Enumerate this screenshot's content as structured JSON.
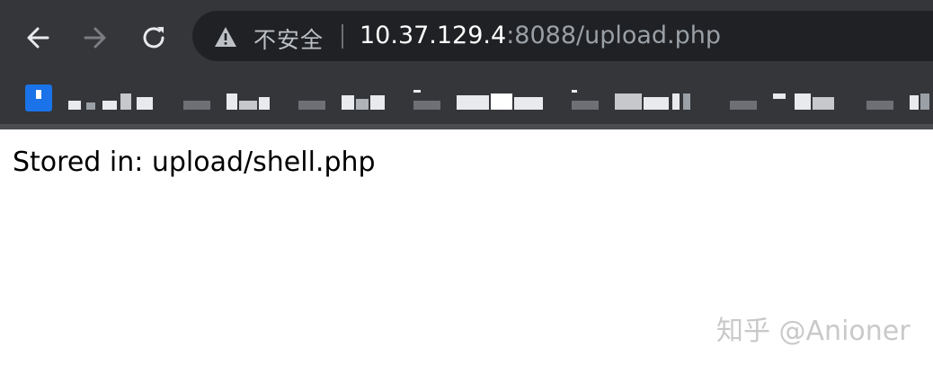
{
  "toolbar": {
    "back_icon": "arrow-left-icon",
    "forward_icon": "arrow-right-icon",
    "reload_icon": "reload-icon"
  },
  "omnibox": {
    "security_icon": "warning-triangle-icon",
    "security_label": "不安全",
    "url_host": "10.37.129.4",
    "url_rest": ":8088/upload.php"
  },
  "bookmarks": {
    "items": [
      {
        "label": ""
      },
      {
        "label": ""
      },
      {
        "label": ""
      },
      {
        "label": ""
      },
      {
        "label": ""
      },
      {
        "label": ""
      },
      {
        "label": ""
      },
      {
        "label": ""
      }
    ]
  },
  "page": {
    "message": "Stored in: upload/shell.php"
  },
  "watermark": {
    "text": "知乎 @Anioner"
  },
  "colors": {
    "toolbar_bg": "#35363a",
    "omnibox_bg": "#202124",
    "url_host": "#ffffff",
    "url_dim": "#9aa0a6",
    "bookmark_icon": "#1a73e8"
  }
}
